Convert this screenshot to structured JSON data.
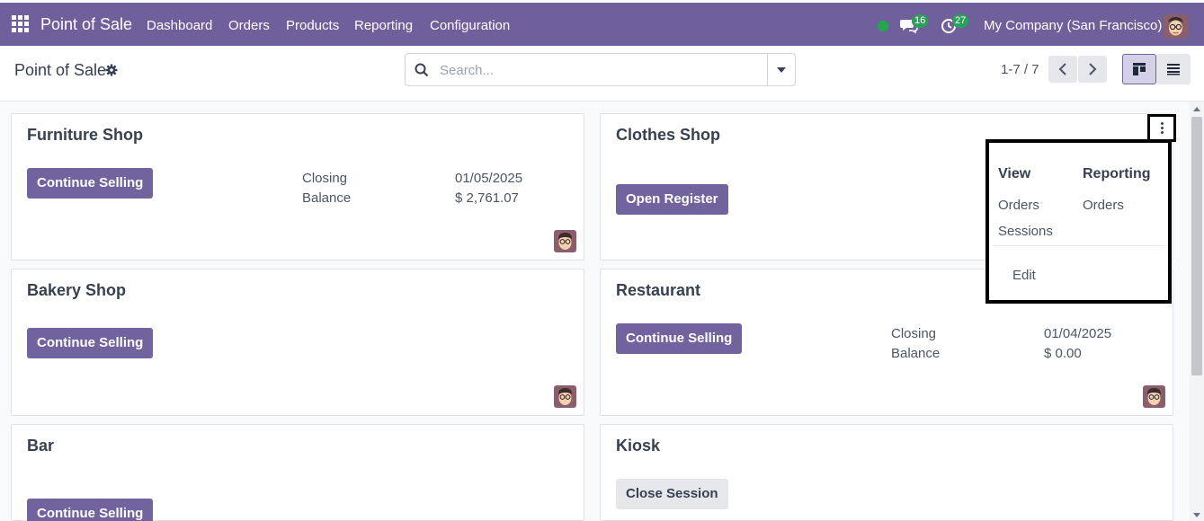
{
  "app": {
    "brand": "Point of Sale",
    "menu": [
      "Dashboard",
      "Orders",
      "Products",
      "Reporting",
      "Configuration"
    ],
    "messages_count": "16",
    "activities_count": "27",
    "company": "My Company (San Francisco)",
    "colors": {
      "navbar": "#6f5f9b",
      "primary": "#71639e",
      "badge": "#2aa05a",
      "online": "#1ea94a"
    }
  },
  "control_panel": {
    "title": "Point of Sale",
    "search_placeholder": "Search...",
    "pager": "1-7 / 7",
    "active_view": "kanban"
  },
  "cards": [
    {
      "name": "Furniture Shop",
      "button": "Continue Selling",
      "closing_label": "Closing",
      "closing_value": "01/05/2025",
      "balance_label": "Balance",
      "balance_value": "$ 2,761.07"
    },
    {
      "name": "Clothes Shop",
      "button": "Open Register"
    },
    {
      "name": "Bakery Shop",
      "button": "Continue Selling"
    },
    {
      "name": "Restaurant",
      "button": "Continue Selling",
      "closing_label": "Closing",
      "closing_value": "01/04/2025",
      "balance_label": "Balance",
      "balance_value": "$ 0.00"
    },
    {
      "name": "Bar",
      "button": "Continue Selling"
    },
    {
      "name": "Kiosk",
      "button": "Close Session"
    }
  ],
  "dropdown": {
    "view_header": "View",
    "view_items": [
      "Orders",
      "Sessions"
    ],
    "reporting_header": "Reporting",
    "reporting_items": [
      "Orders"
    ],
    "edit": "Edit"
  }
}
